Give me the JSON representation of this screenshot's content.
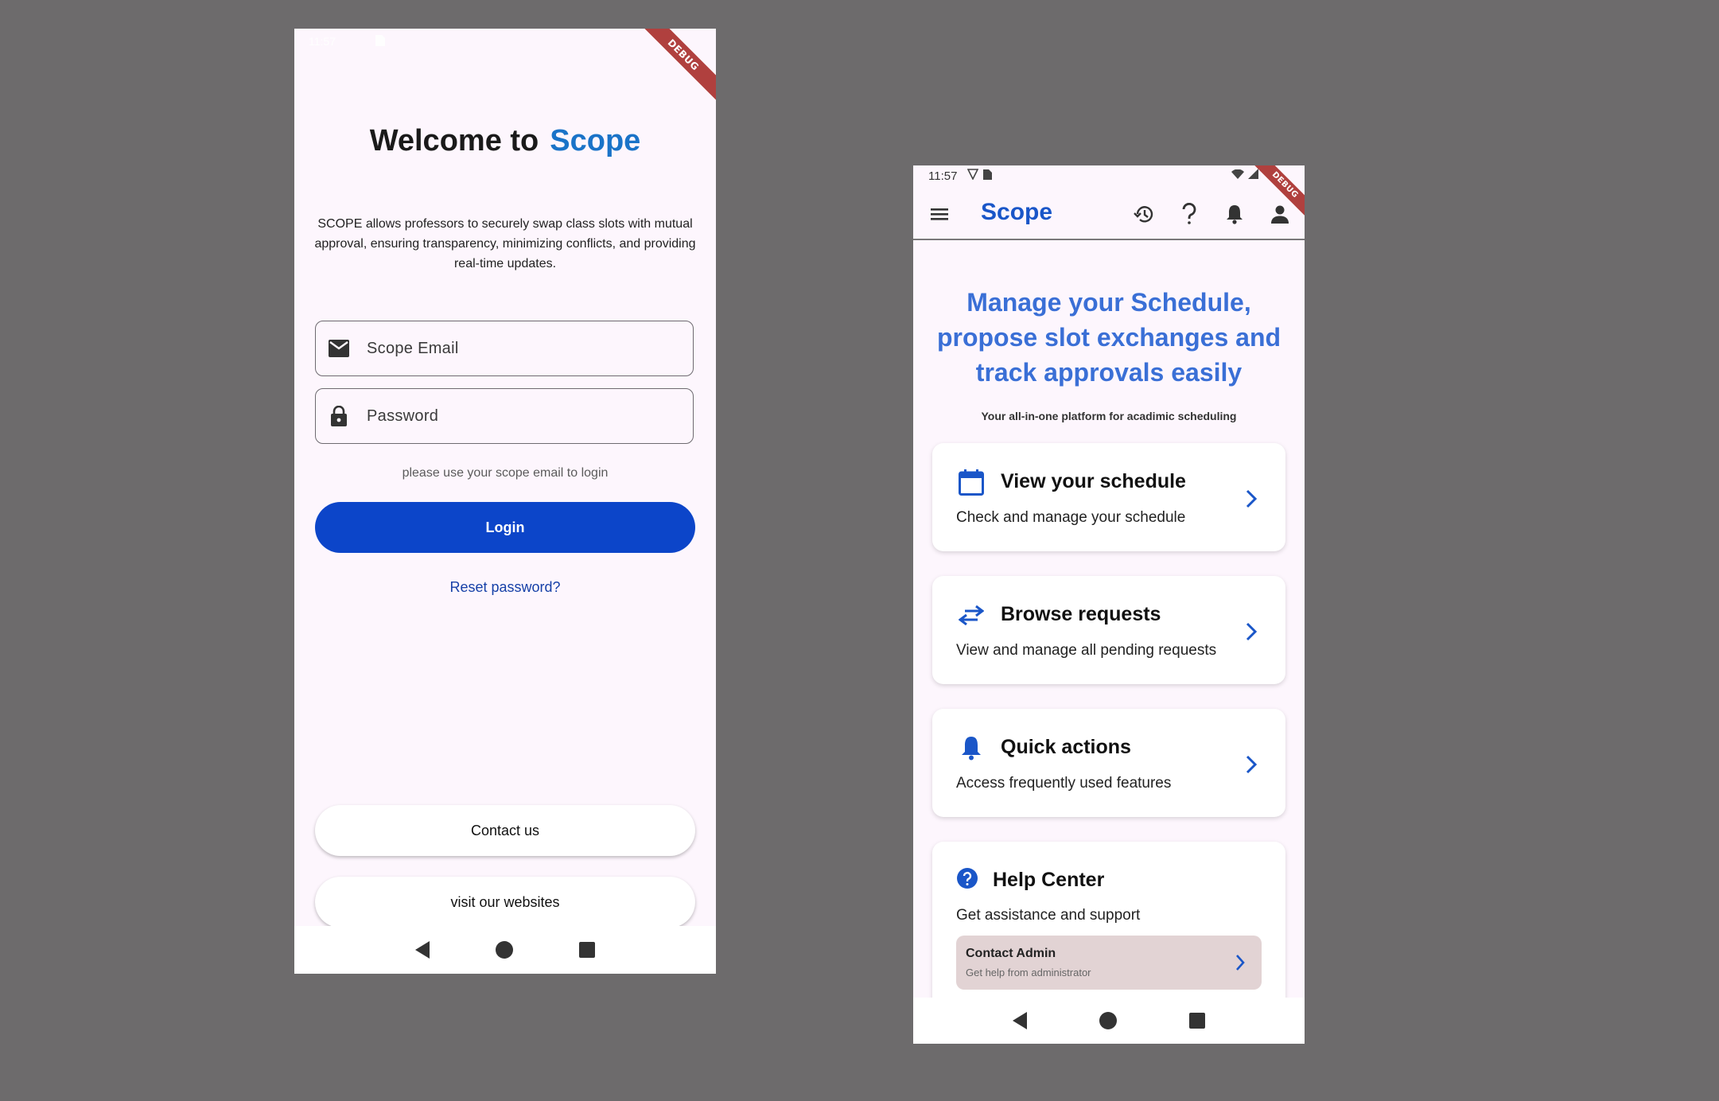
{
  "login": {
    "status_time": "11:57",
    "debug_label": "DEBUG",
    "welcome_prefix": "Welcome to",
    "brand": "Scope",
    "intro": "SCOPE allows professors to securely swap class slots with mutual approval, ensuring transparency, minimizing conflicts, and providing real-time updates.",
    "email_placeholder": "Scope Email",
    "password_placeholder": "Password",
    "hint": "please use your scope email to login",
    "login_label": "Login",
    "reset_label": "Reset password?",
    "contact_label": "Contact us",
    "visit_label": "visit our websites"
  },
  "home": {
    "status_time": "11:57",
    "debug_label": "DEBUG",
    "title": "Scope",
    "headline": "Manage your Schedule, propose slot exchanges and track approvals easily",
    "tagline": "Your all-in-one platform for acadimic scheduling",
    "cards": [
      {
        "title": "View your schedule",
        "subtitle": "Check and manage your schedule",
        "icon": "calendar-icon"
      },
      {
        "title": "Browse requests",
        "subtitle": "View and manage all pending requests",
        "icon": "swap-icon"
      },
      {
        "title": "Quick actions",
        "subtitle": "Access frequently used features",
        "icon": "bell-icon"
      },
      {
        "title": "Help Center",
        "subtitle": "Get assistance and support",
        "icon": "help-icon"
      }
    ],
    "admin": {
      "title": "Contact Admin",
      "subtitle": "Get help from administrator"
    }
  },
  "colors": {
    "brand_blue": "#1a73c8",
    "login_button": "#0c45c9",
    "headline_blue": "#3a6fd6",
    "icon_blue": "#1a56c8",
    "debug_red": "#b0403e"
  }
}
